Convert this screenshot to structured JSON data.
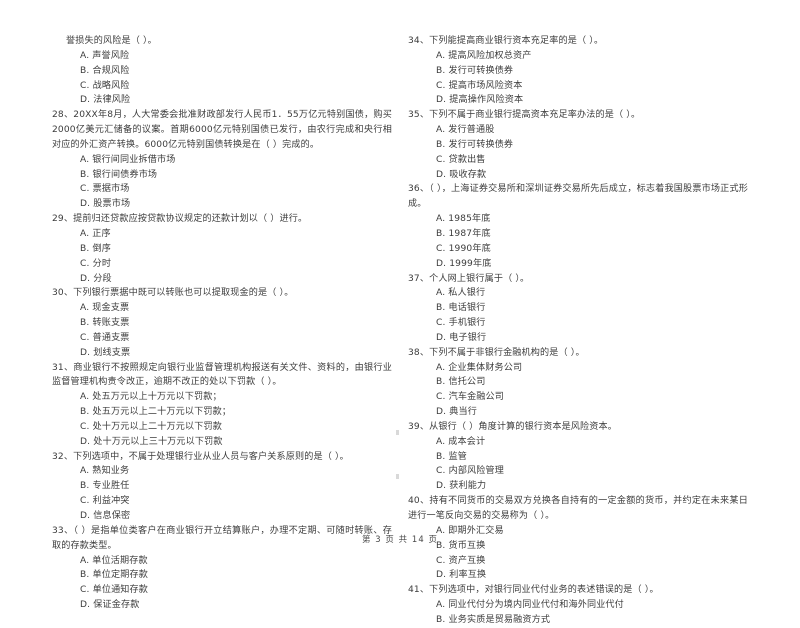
{
  "document": {
    "footer": "第 3 页 共 14 页",
    "page_number": "3",
    "total_pages": "14"
  },
  "left_column": {
    "blocks": [
      {
        "type": "continuation",
        "text": "誉损失的风险是（    ）。"
      },
      {
        "type": "options",
        "items": [
          "A. 声誉风险",
          "B. 合规风险",
          "C. 战略风险",
          "D. 法律风险"
        ]
      },
      {
        "type": "stem",
        "number": "28",
        "text": "28、20XX年8月，人大常委会批准财政部发行人民币1．55万亿元特别国债，购买2000亿美元汇储备的议案。首期6000亿元特别国债已发行，由农行完成和央行相对应的外汇资产转换。6000亿元特别国债转换是在（    ）完成的。"
      },
      {
        "type": "options",
        "items": [
          "A. 银行间同业拆借市场",
          "B. 银行间债券市场",
          "C. 票据市场",
          "D. 股票市场"
        ]
      },
      {
        "type": "stem",
        "number": "29",
        "text": "29、提前归还贷款应按贷款协议规定的还款计划以（    ）进行。"
      },
      {
        "type": "options",
        "items": [
          "A. 正序",
          "B. 倒序",
          "C. 分时",
          "D. 分段"
        ]
      },
      {
        "type": "stem",
        "number": "30",
        "text": "30、下列银行票据中既可以转账也可以提取现金的是（    ）。"
      },
      {
        "type": "options",
        "items": [
          "A. 现金支票",
          "B. 转账支票",
          "C. 普通支票",
          "D. 划线支票"
        ]
      },
      {
        "type": "stem",
        "number": "31",
        "text": "31、商业银行不按照规定向银行业监督管理机构报送有关文件、资料的，由银行业监督管理机构责令改正，逾期不改正的处以下罚款（    ）。"
      },
      {
        "type": "options",
        "items": [
          "A. 处五万元以上十万元以下罚款；",
          "B. 处五万元以上二十万元以下罚款；",
          "C. 处十万元以上二十万元以下罚款",
          "D. 处十万元以上三十万元以下罚款"
        ]
      },
      {
        "type": "stem",
        "number": "32",
        "text": "32、下列选项中，不属于处理银行业从业人员与客户关系原则的是（    ）。"
      },
      {
        "type": "options",
        "items": [
          "A. 熟知业务",
          "B. 专业胜任",
          "C. 利益冲突",
          "D. 信息保密"
        ]
      },
      {
        "type": "stem",
        "number": "33",
        "text": "33、（    ）是指单位类客户在商业银行开立结算账户，办理不定期、可随时转账、存取的存款类型。"
      },
      {
        "type": "options",
        "items": [
          "A. 单位活期存款",
          "B. 单位定期存款",
          "C. 单位通知存款",
          "D. 保证金存款"
        ]
      }
    ]
  },
  "right_column": {
    "blocks": [
      {
        "type": "stem",
        "number": "34",
        "text": "34、下列能提高商业银行资本充足率的是（    ）。"
      },
      {
        "type": "options",
        "items": [
          "A. 提高风险加权总资产",
          "B. 发行可转换债券",
          "C. 提高市场风险资本",
          "D. 提高操作风险资本"
        ]
      },
      {
        "type": "stem",
        "number": "35",
        "text": "35、下列不属于商业银行提高资本充足率办法的是（    ）。"
      },
      {
        "type": "options",
        "items": [
          "A. 发行普通股",
          "B. 发行可转换债券",
          "C. 贷款出售",
          "D. 吸收存款"
        ]
      },
      {
        "type": "stem",
        "number": "36",
        "text": "36、（    ），上海证券交易所和深圳证券交易所先后成立，标志着我国股票市场正式形成。"
      },
      {
        "type": "options",
        "items": [
          "A. 1985年底",
          "B. 1987年底",
          "C. 1990年底",
          "D. 1999年底"
        ]
      },
      {
        "type": "stem",
        "number": "37",
        "text": "37、个人网上银行属于（    ）。"
      },
      {
        "type": "options",
        "items": [
          "A. 私人银行",
          "B. 电话银行",
          "C. 手机银行",
          "D. 电子银行"
        ]
      },
      {
        "type": "stem",
        "number": "38",
        "text": "38、下列不属于非银行金融机构的是（    ）。"
      },
      {
        "type": "options",
        "items": [
          "A. 企业集体财务公司",
          "B. 信托公司",
          "C. 汽车金融公司",
          "D. 典当行"
        ]
      },
      {
        "type": "stem",
        "number": "39",
        "text": "39、从银行（    ）角度计算的银行资本是风险资本。"
      },
      {
        "type": "options",
        "items": [
          "A. 成本会计",
          "B. 监管",
          "C. 内部风险管理",
          "D. 获利能力"
        ]
      },
      {
        "type": "stem",
        "number": "40",
        "text": "40、持有不同货币的交易双方兑换各自持有的一定金额的货币，并约定在未来某日进行一笔反向交易的交易称为（    ）。"
      },
      {
        "type": "options",
        "items": [
          "A. 即期外汇交易",
          "B. 货币互换",
          "C. 资产互换",
          "D. 利率互换"
        ]
      },
      {
        "type": "stem",
        "number": "41",
        "text": "41、下列选项中，对银行同业代付业务的表述错误的是（    ）。"
      },
      {
        "type": "options",
        "items": [
          "A. 同业代付分为境内同业代付和海外同业代付",
          "B. 业务实质是贸易融资方式"
        ]
      }
    ]
  }
}
